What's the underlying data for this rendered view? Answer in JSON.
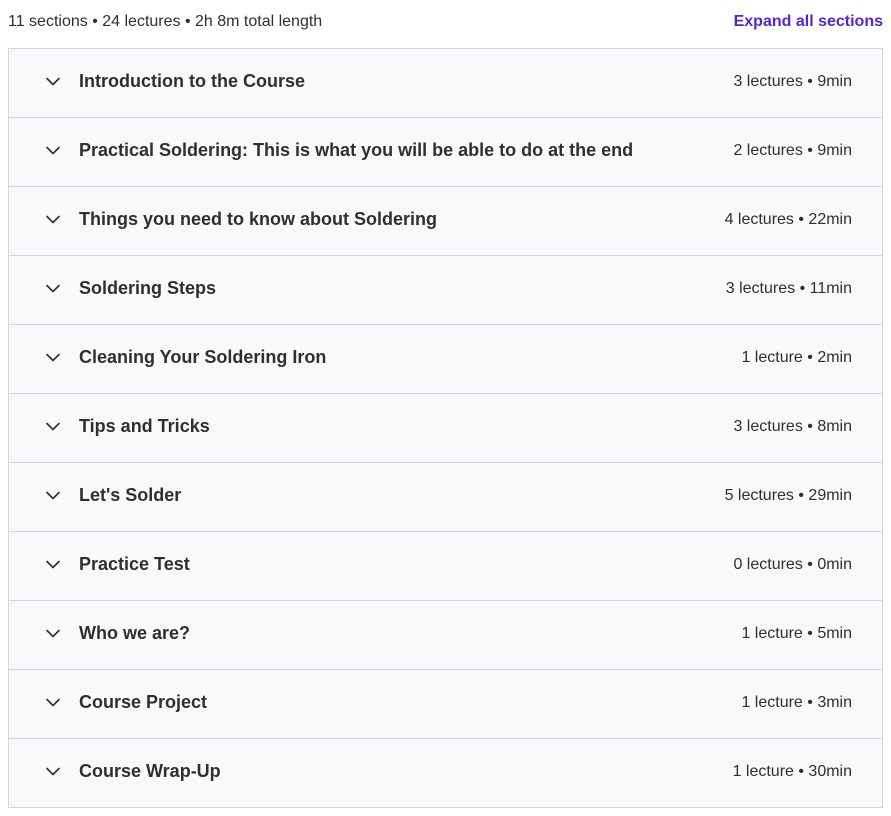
{
  "summary": {
    "text": "11 sections • 24 lectures • 2h 8m total length",
    "expand_label": "Expand all sections"
  },
  "icons": {
    "section_toggle": "chevron-down-icon"
  },
  "colors": {
    "accent": "#5624d0",
    "row_bg": "#f7f9fa",
    "border": "#d1d7dc",
    "text": "#2d2f31"
  },
  "sections": [
    {
      "title": "Introduction to the Course",
      "meta": "3 lectures • 9min"
    },
    {
      "title": "Practical Soldering: This is what you will be able to do at the end",
      "meta": "2 lectures • 9min"
    },
    {
      "title": "Things you need to know about Soldering",
      "meta": "4 lectures • 22min"
    },
    {
      "title": "Soldering Steps",
      "meta": "3 lectures • 11min"
    },
    {
      "title": "Cleaning Your Soldering Iron",
      "meta": "1 lecture • 2min"
    },
    {
      "title": "Tips and Tricks",
      "meta": "3 lectures • 8min"
    },
    {
      "title": "Let's Solder",
      "meta": "5 lectures • 29min"
    },
    {
      "title": "Practice Test",
      "meta": "0 lectures • 0min"
    },
    {
      "title": "Who we are?",
      "meta": "1 lecture • 5min"
    },
    {
      "title": "Course Project",
      "meta": "1 lecture • 3min"
    },
    {
      "title": "Course Wrap-Up",
      "meta": "1 lecture • 30min"
    }
  ]
}
